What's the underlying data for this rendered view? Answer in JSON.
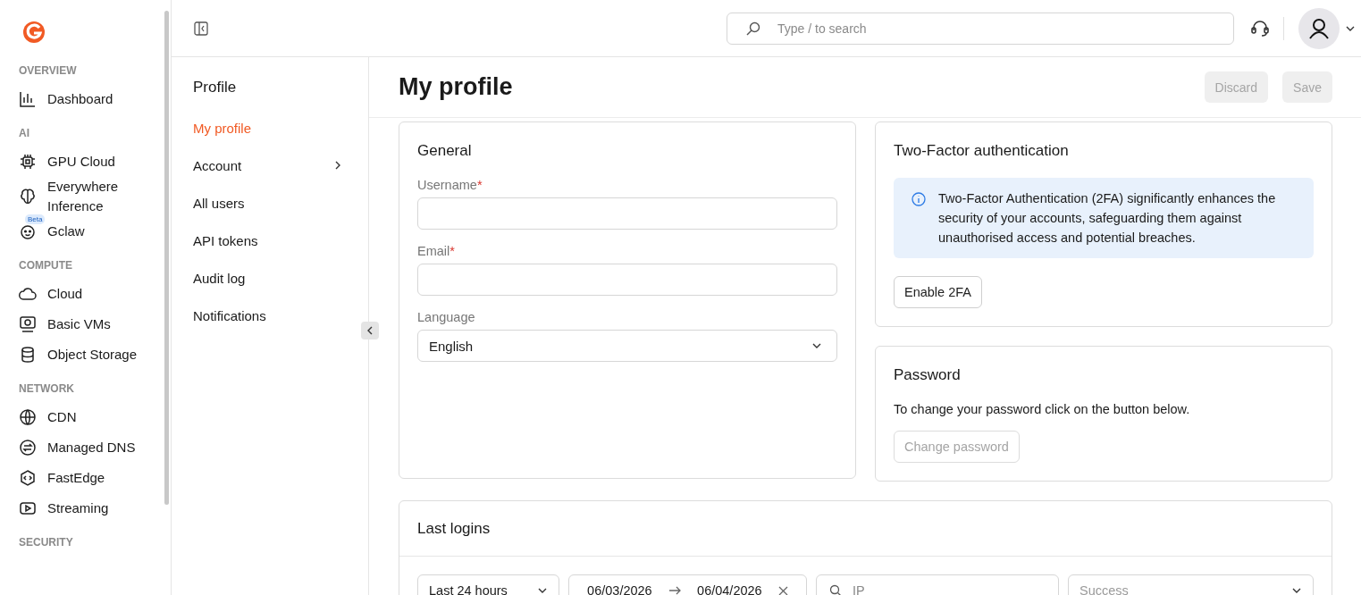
{
  "sidebar": {
    "sections": [
      {
        "title": "OVERVIEW",
        "items": [
          {
            "label": "Dashboard"
          }
        ]
      },
      {
        "title": "AI",
        "items": [
          {
            "label": "GPU Cloud"
          },
          {
            "label": "Everywhere Inference"
          },
          {
            "label": "Gclaw",
            "badge": "Beta"
          }
        ]
      },
      {
        "title": "COMPUTE",
        "items": [
          {
            "label": "Cloud"
          },
          {
            "label": "Basic VMs"
          },
          {
            "label": "Object Storage"
          }
        ]
      },
      {
        "title": "NETWORK",
        "items": [
          {
            "label": "CDN"
          },
          {
            "label": "Managed DNS"
          },
          {
            "label": "FastEdge"
          },
          {
            "label": "Streaming"
          }
        ]
      },
      {
        "title": "SECURITY"
      }
    ]
  },
  "search": {
    "placeholder": "Type / to search"
  },
  "subnav": {
    "title": "Profile",
    "items": [
      {
        "label": "My profile",
        "selected": true,
        "submenu": false
      },
      {
        "label": "Account",
        "selected": false,
        "submenu": true
      },
      {
        "label": "All users",
        "selected": false,
        "submenu": false
      },
      {
        "label": "API tokens",
        "selected": false,
        "submenu": false
      },
      {
        "label": "Audit log",
        "selected": false,
        "submenu": false
      },
      {
        "label": "Notifications",
        "selected": false,
        "submenu": false
      }
    ]
  },
  "page": {
    "title": "My profile",
    "buttons": [
      {
        "label": "Discard",
        "disabled": true
      },
      {
        "label": "Save",
        "disabled": true
      }
    ]
  },
  "general": {
    "title": "General",
    "fields": [
      {
        "kind": "input",
        "label": "Username",
        "required_mark": "*"
      },
      {
        "kind": "input",
        "label": "Email",
        "required_mark": "*"
      },
      {
        "kind": "select",
        "label": "Language",
        "value": "English"
      }
    ]
  },
  "two_factor": {
    "title": "Two-Factor authentication",
    "info": "Two-Factor Authentication (2FA) significantly enhances the security of your accounts, safeguarding them against unauthorised access and potential breaches.",
    "button": {
      "label": "Enable 2FA",
      "disabled": false
    }
  },
  "password": {
    "title": "Password",
    "text": "To change your password click on the button below.",
    "button": {
      "label": "Change password",
      "disabled": true
    }
  },
  "last_logins": {
    "title": "Last logins",
    "period": "Last 24 hours",
    "date_from": "06/03/2026",
    "date_to": "06/04/2026",
    "ip_placeholder": "IP",
    "status_placeholder": "Success"
  }
}
